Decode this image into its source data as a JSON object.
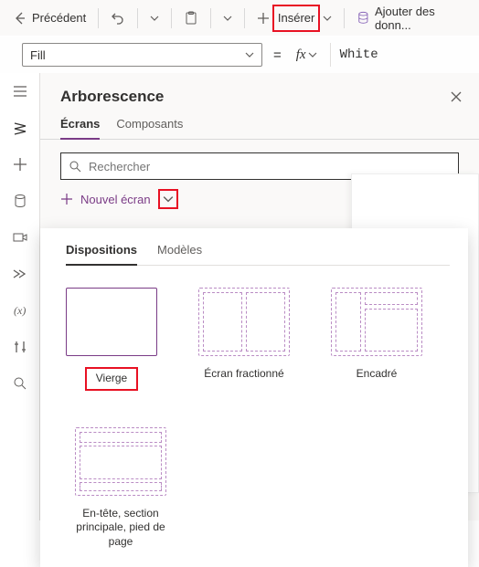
{
  "topbar": {
    "back": "Précédent",
    "insert": "Insérer",
    "add_data": "Ajouter des donn..."
  },
  "formula": {
    "property": "Fill",
    "value": "White"
  },
  "tree": {
    "title": "Arborescence",
    "tabs": {
      "screens": "Écrans",
      "components": "Composants"
    },
    "search_placeholder": "Rechercher",
    "new_screen": "Nouvel écran"
  },
  "dropdown": {
    "tabs": {
      "layouts": "Dispositions",
      "templates": "Modèles"
    },
    "items": {
      "blank": "Vierge",
      "split": "Écran fractionné",
      "sidebar": "Encadré",
      "header": "En-tête, section principale, pied de page"
    }
  }
}
